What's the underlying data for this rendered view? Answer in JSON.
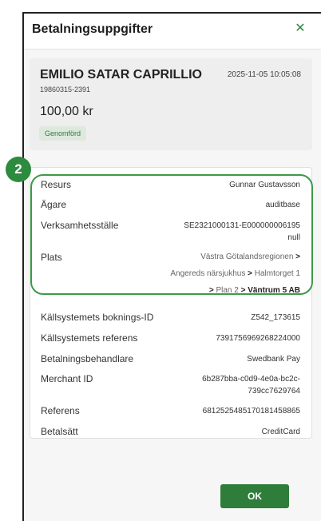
{
  "dialog": {
    "title": "Betalningsuppgifter",
    "close_icon": "close-icon"
  },
  "summary": {
    "name": "EMILIO SATAR CAPRILLIO",
    "person_id": "19860315-2391",
    "date": "2025-11-05 10:05:08",
    "amount": "100,00 kr",
    "status": "Genomförd"
  },
  "step_badge": "2",
  "details": {
    "resurs": {
      "label": "Resurs",
      "value": "Gunnar Gustavsson"
    },
    "agare": {
      "label": "Ägare",
      "value": "auditbase"
    },
    "verksamhet": {
      "label": "Verksamhetsställe",
      "value_line1": "SE2321000131-E000000006195",
      "value_line2": "null"
    },
    "plats": {
      "label": "Plats",
      "crumb1": "Västra Götalandsregionen",
      "crumb2": "Angereds närsjukhus",
      "crumb3": "Halmtorget 1",
      "crumb4": "Plan 2",
      "crumb5": "Väntrum 5 AB",
      "separator": ">"
    },
    "booking_id": {
      "label": "Källsystemets boknings-ID",
      "value": "Z542_173615"
    },
    "source_ref": {
      "label": "Källsystemets referens",
      "value": "7391756969268224000"
    },
    "handler": {
      "label": "Betalningsbehandlare",
      "value": "Swedbank Pay"
    },
    "merchant": {
      "label": "Merchant ID",
      "value_line1": "6b287bba-c0d9-4e0a-bc2c-",
      "value_line2": "739cc7629764"
    },
    "reference": {
      "label": "Referens",
      "value": "681252548517018145886​5"
    },
    "method": {
      "label": "Betalsätt",
      "value": "CreditCard"
    }
  },
  "footer": {
    "ok_label": "OK"
  },
  "colors": {
    "accent": "#2e8a3e",
    "ring": "#3d9a48"
  }
}
